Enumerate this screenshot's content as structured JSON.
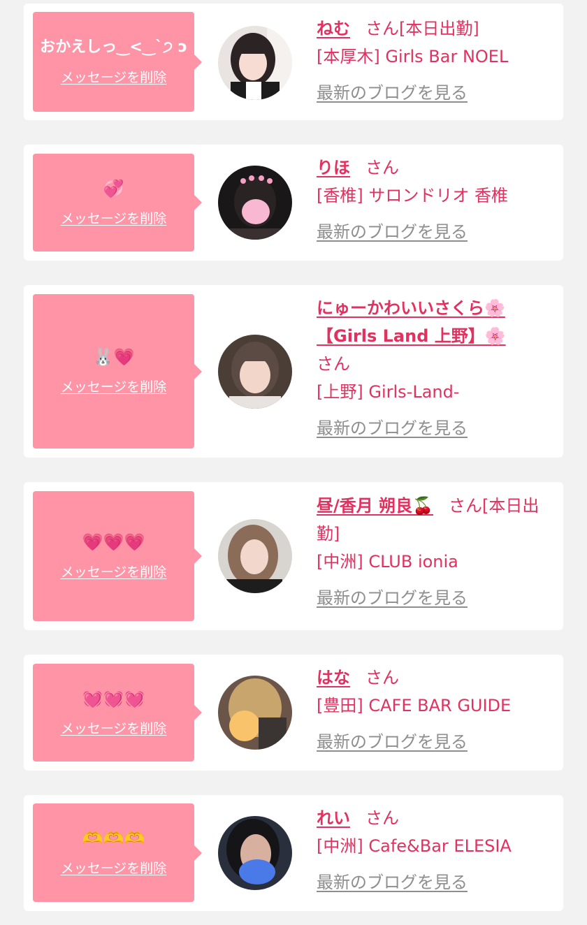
{
  "colors": {
    "background": "#f2f2f2",
    "card": "#ffffff",
    "bubble": "#fe94a6",
    "accent": "#e2315f",
    "link_gray": "#8e8e8e"
  },
  "entries": [
    {
      "message": "おかえしっ‿<‿`੭ ɔ",
      "delete_label": "メッセージを削除",
      "name": "ねむ",
      "honorific": "さん",
      "status": "[本日出勤]",
      "shop": "[本厚木] Girls Bar NOEL",
      "blog_label": "最新のブログを見る",
      "avatar_icon": "girl-portrait-avatar"
    },
    {
      "message": "💞",
      "delete_label": "メッセージを削除",
      "name": "りほ",
      "honorific": "さん",
      "status": "",
      "shop": "[香椎] サロンドリオ 香椎",
      "blog_label": "最新のブログを見る",
      "avatar_icon": "girl-portrait-avatar"
    },
    {
      "message": "🐰💗",
      "delete_label": "メッセージを削除",
      "name": "にゅーかわいいさくら🌸【Girls Land 上野】🌸",
      "honorific": "さん",
      "status": "",
      "shop": "[上野] Girls-Land-",
      "blog_label": "最新のブログを見る",
      "avatar_icon": "girl-portrait-avatar"
    },
    {
      "message": "💗💗💗",
      "delete_label": "メッセージを削除",
      "name": "昼/香月 朔良🍒",
      "honorific": "さん",
      "status": "[本日出勤]",
      "shop": "[中洲] CLUB ionia",
      "blog_label": "最新のブログを見る",
      "avatar_icon": "girl-portrait-avatar"
    },
    {
      "message": "💓💓💓",
      "delete_label": "メッセージを削除",
      "name": "はな",
      "honorific": "さん",
      "status": "",
      "shop": "[豊田] CAFE BAR GUIDE",
      "blog_label": "最新のブログを見る",
      "avatar_icon": "girl-portrait-avatar"
    },
    {
      "message": "🫶🫶🫶",
      "delete_label": "メッセージを削除",
      "name": "れい",
      "honorific": "さん",
      "status": "",
      "shop": "[中洲] Cafe&Bar ELESIA",
      "blog_label": "最新のブログを見る",
      "avatar_icon": "girl-portrait-avatar"
    }
  ]
}
